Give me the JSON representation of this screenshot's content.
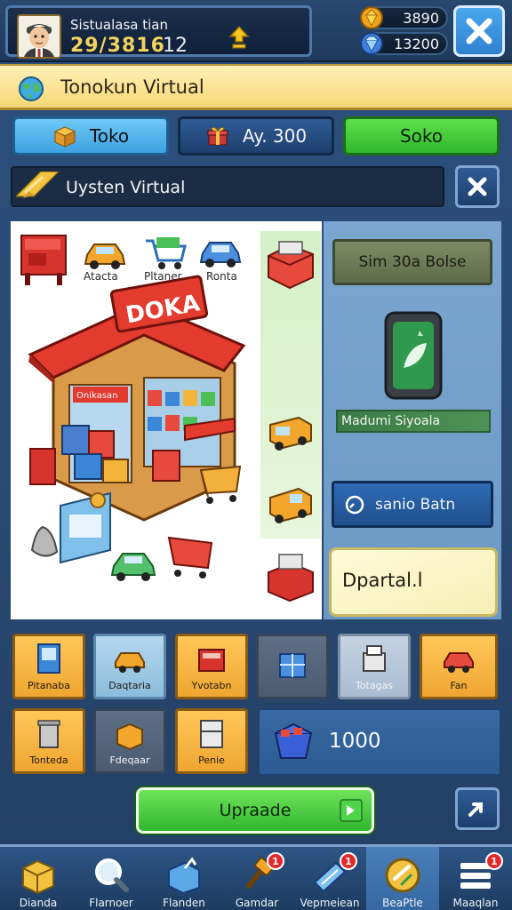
{
  "header": {
    "player_name": "Sistualasa tian",
    "player_stat": "29/3816",
    "player_rank": "12",
    "resources": [
      {
        "icon": "gold-gem-icon",
        "value": "3890"
      },
      {
        "icon": "blue-gem-icon",
        "value": "13200"
      }
    ]
  },
  "title": "Tonokun Virtual",
  "tabs": {
    "toko": "Toko",
    "day": "Ay. 300",
    "soko": "Soko"
  },
  "system_bar": {
    "label": "Uysten Virtual"
  },
  "scene": {
    "shop_sign": "DOKA",
    "shop_banner": "Onikasan",
    "vehicles": [
      {
        "label": "Atacta"
      },
      {
        "label": "Pltaner"
      },
      {
        "label": "Ronta"
      }
    ]
  },
  "right_panel": {
    "top_button": "Sim 30a Bolse",
    "card_label": "Madumi Siyoala",
    "action_button": "sanio Batn",
    "note": "Dpartal.l"
  },
  "items": [
    {
      "label": "Pitanaba"
    },
    {
      "label": "Daqtaria"
    },
    {
      "label": "Yvotabn"
    },
    {
      "label": ""
    },
    {
      "label": "Totagas"
    },
    {
      "label": "Fan"
    },
    {
      "label": "Tonteda"
    },
    {
      "label": "Fdeqaar"
    },
    {
      "label": "Penie"
    }
  ],
  "count_panel": {
    "value": "1000"
  },
  "upgrade": {
    "label": "Upraade"
  },
  "bottom_nav": [
    {
      "label": "Dianda",
      "icon": "box-icon",
      "badge": ""
    },
    {
      "label": "Flarnoer",
      "icon": "magnifier-icon",
      "badge": ""
    },
    {
      "label": "Flanden",
      "icon": "crate-icon",
      "badge": ""
    },
    {
      "label": "Gamdar",
      "icon": "hammer-icon",
      "badge": "1"
    },
    {
      "label": "Vepmeiean",
      "icon": "ticket-icon",
      "badge": "1"
    },
    {
      "label": "BeaPtle",
      "icon": "coin-icon",
      "badge": ""
    },
    {
      "label": "Maaqlan",
      "icon": "menu-list-icon",
      "badge": "1"
    }
  ],
  "colors": {
    "accent_green": "#31b62d",
    "accent_blue": "#3ea2e2",
    "tile_orange": "#f0a530",
    "badge_red": "#e22a2a"
  }
}
